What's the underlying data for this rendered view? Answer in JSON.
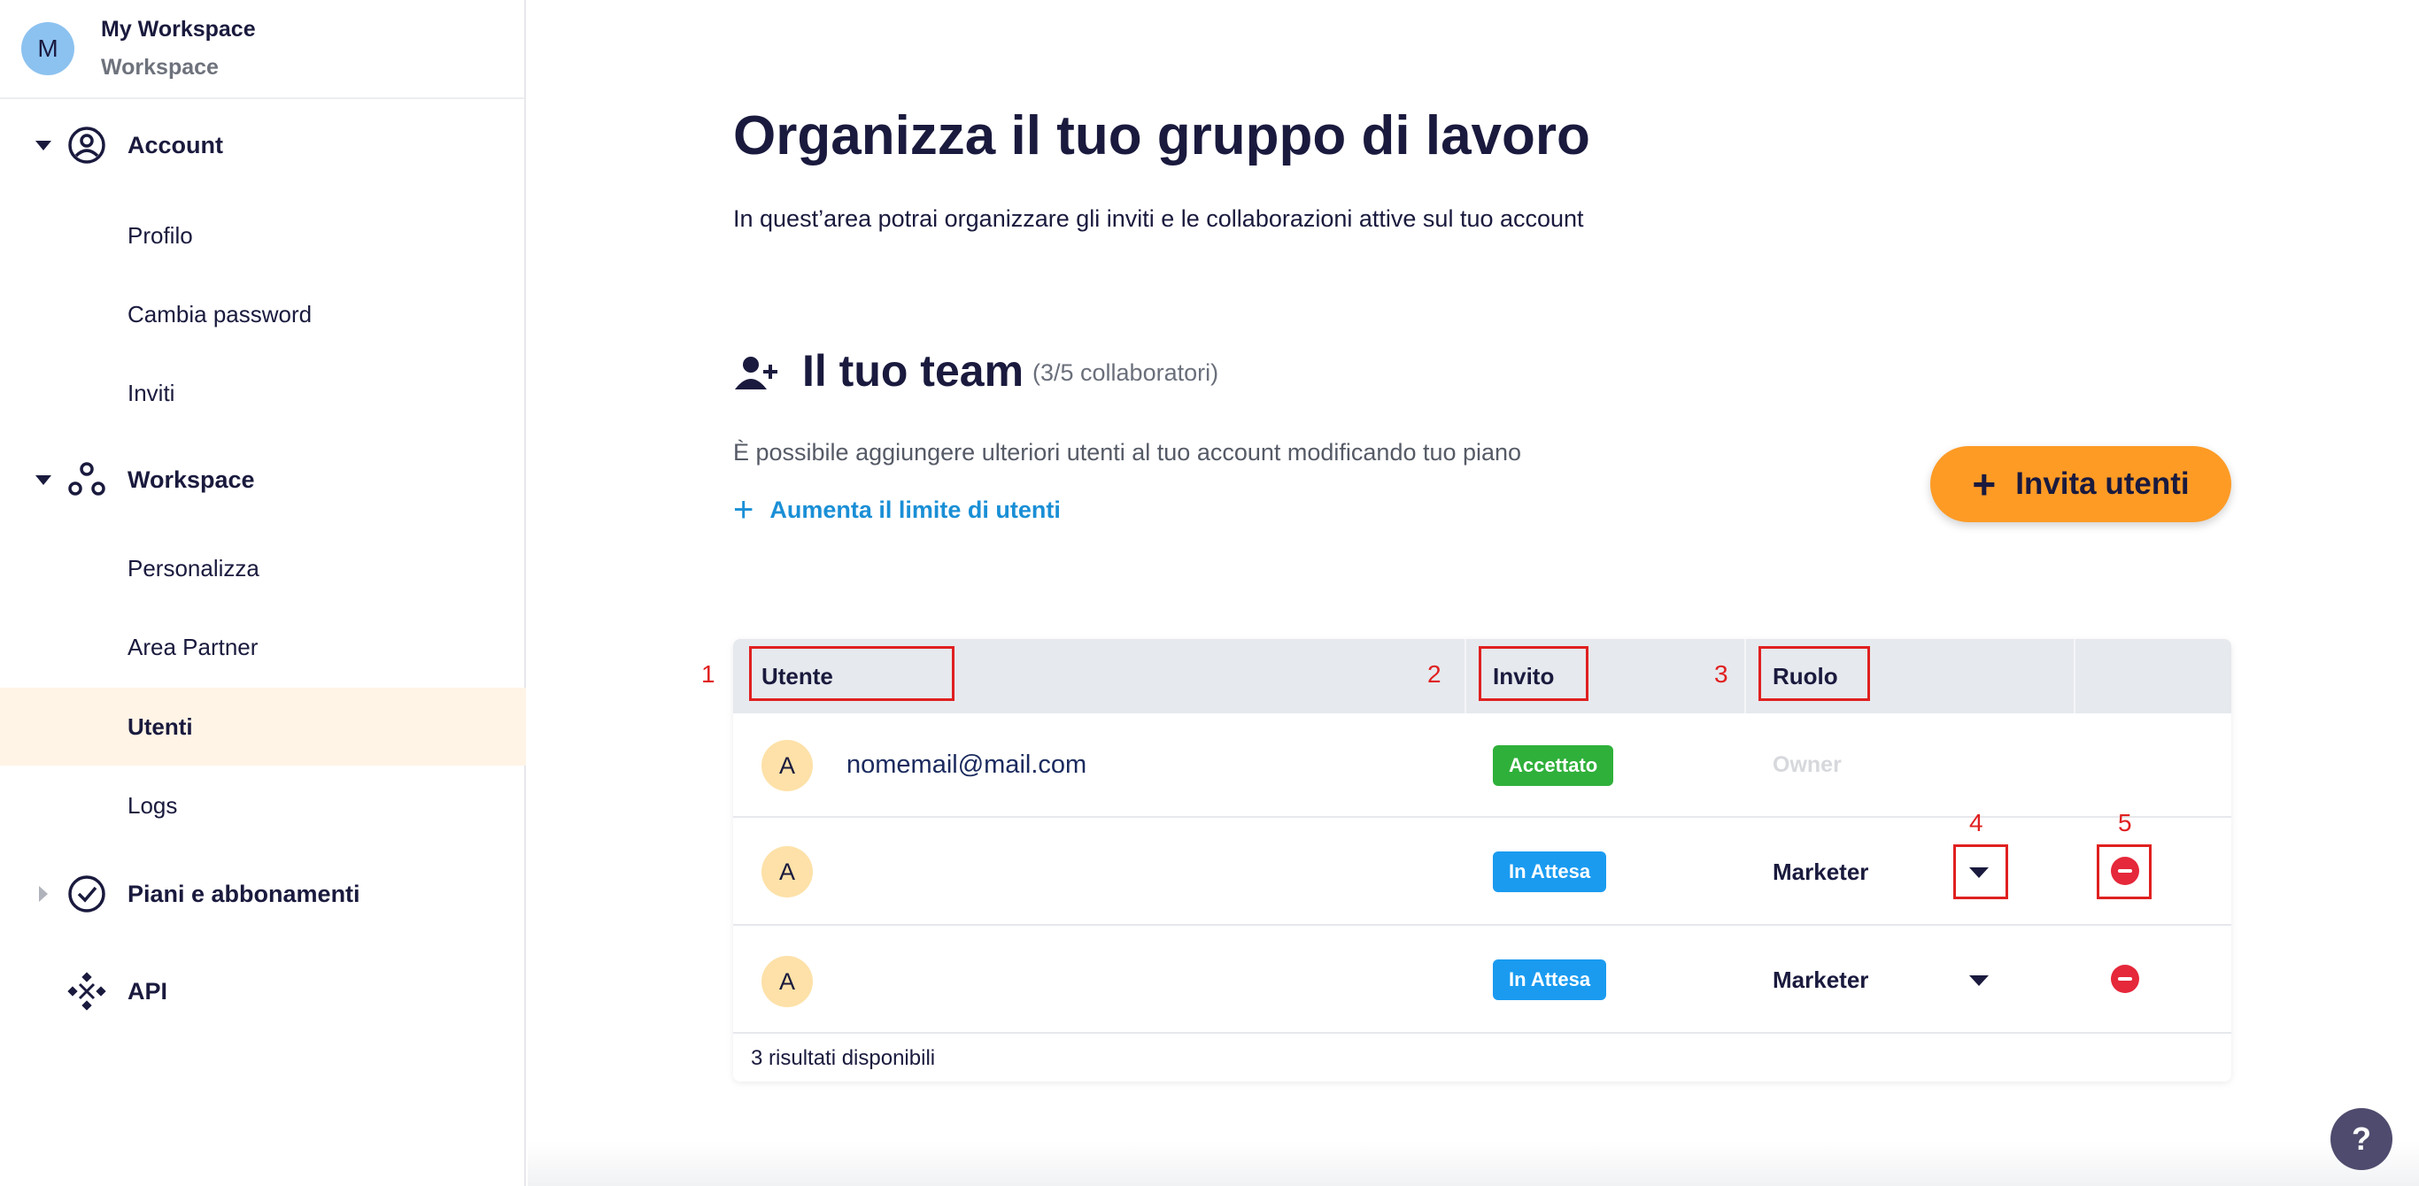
{
  "workspace": {
    "initial": "M",
    "name": "My Workspace",
    "type": "Workspace"
  },
  "sidebar": {
    "account": {
      "label": "Account",
      "items": [
        "Profilo",
        "Cambia password",
        "Inviti"
      ]
    },
    "workspace": {
      "label": "Workspace",
      "items": [
        "Personalizza",
        "Area Partner",
        "Utenti",
        "Logs"
      ],
      "active": "Utenti"
    },
    "plans": {
      "label": "Piani e abbonamenti"
    },
    "api": {
      "label": "API"
    }
  },
  "main": {
    "title": "Organizza il tuo gruppo di lavoro",
    "description": "In quest’area potrai organizzare gli inviti e le collaborazioni attive sul tuo account",
    "team": {
      "title": "Il tuo team",
      "count": "(3/5 collaboratori)",
      "hint": "È possibile aggiungere ulteriori utenti al tuo account modificando tuo piano",
      "limit_link": "Aumenta il limite di utenti",
      "invite_button": "Invita utenti"
    },
    "table": {
      "headers": {
        "user": "Utente",
        "invite": "Invito",
        "role": "Ruolo"
      },
      "markers": [
        "1",
        "2",
        "3",
        "4",
        "5"
      ],
      "rows": [
        {
          "avatar": "A",
          "email": "nomemail@mail.com",
          "status": "Accettato",
          "role": "Owner"
        },
        {
          "avatar": "A",
          "email": "",
          "status": "In Attesa",
          "role": "Marketer"
        },
        {
          "avatar": "A",
          "email": "",
          "status": "In Attesa",
          "role": "Marketer"
        }
      ],
      "footer": "3 risultati disponibili"
    }
  },
  "help_label": "?",
  "colors": {
    "accent": "#fd9b25",
    "link": "#1a8fd6",
    "accepted": "#2fb03a",
    "pending": "#1a9bf0",
    "remove": "#e5283a",
    "annotation": "#e02020"
  }
}
